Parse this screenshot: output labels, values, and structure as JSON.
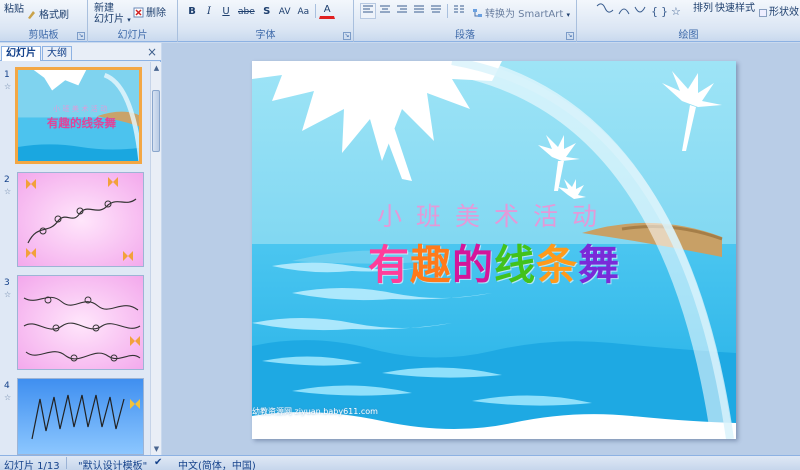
{
  "ribbon": {
    "clipboard": {
      "paste": "粘贴",
      "format_painter": "格式刷",
      "label": "剪贴板"
    },
    "slides": {
      "new_slide": "新建",
      "new_slide_sub": "幻灯片",
      "delete": "删除",
      "label": "幻灯片"
    },
    "font": {
      "bold": "B",
      "italic": "I",
      "underline": "U",
      "strike": "abe",
      "shadow": "S",
      "spacing": "AV",
      "case": "Aa",
      "color": "A",
      "label": "字体"
    },
    "paragraph": {
      "smartart": "转换为 SmartArt",
      "label": "段落"
    },
    "drawing": {
      "arrange": "排列",
      "quick_styles": "快速样式",
      "shape_effects": "形状效",
      "label": "绘图"
    }
  },
  "left_pane": {
    "tab_slides": "幻灯片",
    "tab_outline": "大纲",
    "close": "×",
    "thumbnails": [
      {
        "num": "1",
        "subtitle": "小班美术活动",
        "title": "有趣的线条舞"
      },
      {
        "num": "2"
      },
      {
        "num": "3"
      },
      {
        "num": "4"
      }
    ]
  },
  "slide": {
    "subtitle": "小班美术活动",
    "title_chars": [
      "有",
      "趣",
      "的",
      "线",
      "条",
      "舞"
    ],
    "watermark": "幼教资源网 ziyuan.baby611.com"
  },
  "colors": {
    "title_chars": [
      "#ff3d9a",
      "#ff7a1a",
      "#d4169a",
      "#42c21c",
      "#ff9a1a",
      "#7a2ad8"
    ],
    "sea_dark": "#1aa7e0",
    "sky": "#7fd3ef",
    "selected_border": "#f3a744"
  },
  "status": {
    "slide_info": "幻灯片 1/13",
    "theme": "\"默认设计模板\"",
    "language": "中文(简体，中国)"
  }
}
